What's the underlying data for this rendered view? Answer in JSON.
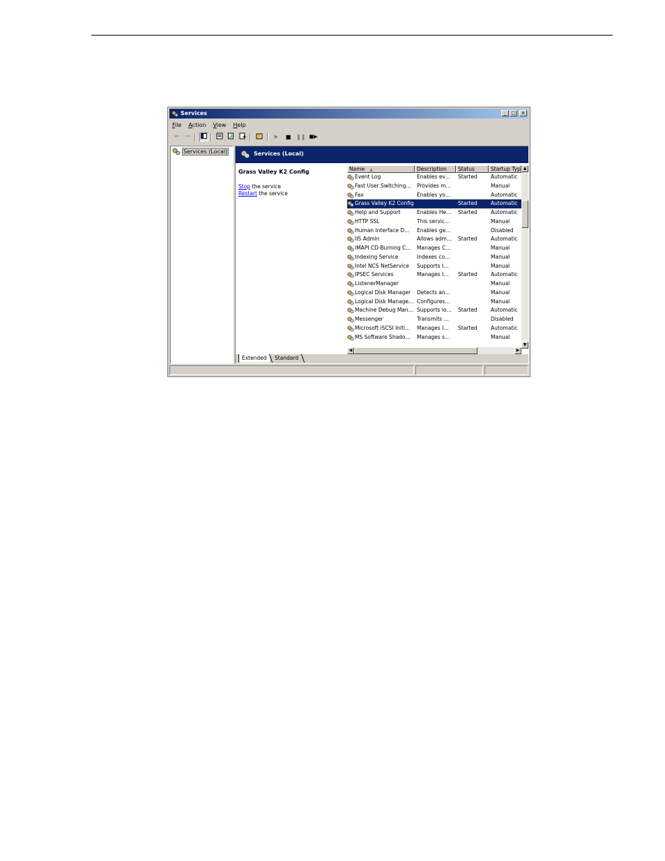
{
  "window": {
    "title": "Services",
    "controls": [
      "_",
      "□",
      "x"
    ]
  },
  "menu": [
    {
      "key": "F",
      "rest": "ile"
    },
    {
      "key": "A",
      "rest": "ction"
    },
    {
      "key": "V",
      "rest": "iew"
    },
    {
      "key": "H",
      "rest": "elp"
    }
  ],
  "toolbar": {
    "icons": [
      "back-icon",
      "forward-icon",
      "show-hide-tree-icon",
      "properties-icon",
      "refresh-icon",
      "export-list-icon",
      "help-icon",
      "start-service-icon",
      "stop-service-icon",
      "pause-service-icon",
      "restart-service-icon"
    ]
  },
  "tree": {
    "root_label": "Services (Local)"
  },
  "pane": {
    "header": "Services (Local)",
    "service_title": "Grass Valley K2 Config",
    "action1_link": "Stop",
    "action1_rest": " the service",
    "action2_link": "Restart",
    "action2_rest": " the service"
  },
  "columns": {
    "name": "Name",
    "sort_arrow": "▲",
    "description": "Description",
    "status": "Status",
    "startup": "Startup Typ"
  },
  "services": [
    {
      "name": "Event Log",
      "description": "Enables ev…",
      "status": "Started",
      "startup": "Automatic"
    },
    {
      "name": "Fast User Switching…",
      "description": "Provides m…",
      "status": "",
      "startup": "Manual"
    },
    {
      "name": "Fax",
      "description": "Enables yo…",
      "status": "",
      "startup": "Automatic"
    },
    {
      "name": "Grass Valley K2 Config",
      "description": "",
      "status": "Started",
      "startup": "Automatic",
      "selected": true
    },
    {
      "name": "Help and Support",
      "description": "Enables He…",
      "status": "Started",
      "startup": "Automatic"
    },
    {
      "name": "HTTP SSL",
      "description": "This servic…",
      "status": "",
      "startup": "Manual"
    },
    {
      "name": "Human Interface D…",
      "description": "Enables ge…",
      "status": "",
      "startup": "Disabled"
    },
    {
      "name": "IIS Admin",
      "description": "Allows adm…",
      "status": "Started",
      "startup": "Automatic"
    },
    {
      "name": "IMAPI CD-Burning C…",
      "description": "Manages C…",
      "status": "",
      "startup": "Manual"
    },
    {
      "name": "Indexing Service",
      "description": "Indexes co…",
      "status": "",
      "startup": "Manual"
    },
    {
      "name": "Intel NCS NetService",
      "description": "Supports I…",
      "status": "",
      "startup": "Manual"
    },
    {
      "name": "IPSEC Services",
      "description": "Manages I…",
      "status": "Started",
      "startup": "Automatic"
    },
    {
      "name": "ListenerManager",
      "description": "",
      "status": "",
      "startup": "Manual"
    },
    {
      "name": "Logical Disk Manager",
      "description": "Detects an…",
      "status": "",
      "startup": "Manual"
    },
    {
      "name": "Logical Disk Manage…",
      "description": "Configures…",
      "status": "",
      "startup": "Manual"
    },
    {
      "name": "Machine Debug Man…",
      "description": "Supports lo…",
      "status": "Started",
      "startup": "Automatic"
    },
    {
      "name": "Messenger",
      "description": "Transmits …",
      "status": "",
      "startup": "Disabled"
    },
    {
      "name": "Microsoft iSCSI Initi…",
      "description": "Manages I…",
      "status": "Started",
      "startup": "Automatic"
    },
    {
      "name": "MS Software Shado…",
      "description": "Manages s…",
      "status": "",
      "startup": "Manual"
    }
  ],
  "tabs": {
    "extended": "Extended",
    "standard": "Standard"
  }
}
